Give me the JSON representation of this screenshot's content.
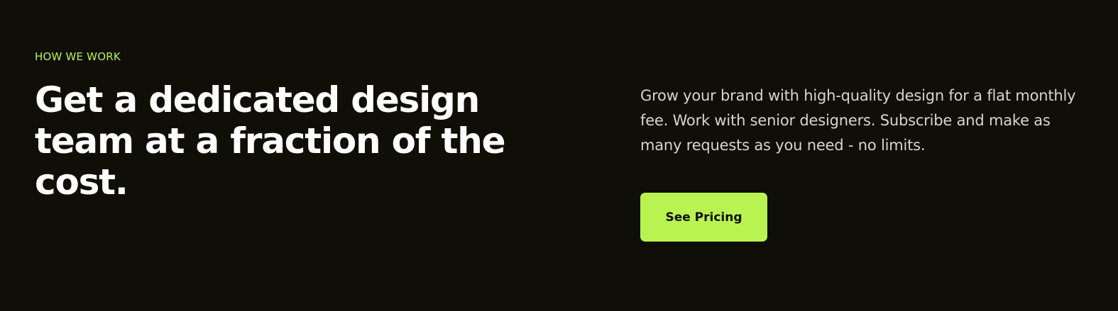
{
  "section": {
    "eyebrow": "HOW WE WORK",
    "headline": "Get a dedicated design team at a fraction of the cost.",
    "description": "Grow your brand with high-quality design for a flat monthly fee. Work with senior designers. Subscribe and make as many requests as you need - no limits.",
    "cta_label": "See Pricing"
  },
  "colors": {
    "background": "#0f0f07",
    "accent": "#b8f352",
    "heading": "#ffffff",
    "body_text": "#d6d6d0"
  }
}
